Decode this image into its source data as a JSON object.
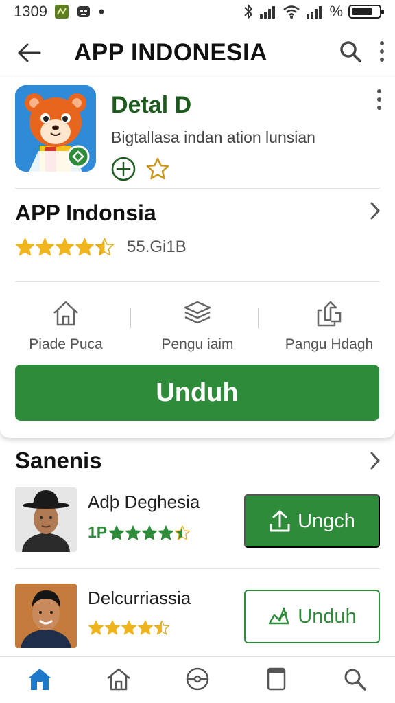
{
  "status_bar": {
    "time": "1309",
    "signal_percent": "%"
  },
  "app_bar": {
    "title": "APP INDONESIA"
  },
  "header": {
    "title": "Detal D",
    "subtitle": "Bigtallasa indan ation lunsian"
  },
  "rating_section": {
    "title": "APP Indonsia",
    "rating": 4.5,
    "size": "55.Gi1B"
  },
  "actions": [
    {
      "label": "Piade Puca",
      "icon": "home-outline-icon"
    },
    {
      "label": "Pengu iaim",
      "icon": "layers-icon"
    },
    {
      "label": "Pangu Hdagh",
      "icon": "share-icon"
    }
  ],
  "primary_button": {
    "label": "Unduh"
  },
  "section": {
    "title": "Sanenis"
  },
  "list": [
    {
      "name": "Adþ Deghesia",
      "prefix": "1P",
      "rating": 4.5,
      "button": "Ungch",
      "style": "filled"
    },
    {
      "name": "Delcurriassia",
      "prefix": "",
      "rating": 4.5,
      "button": "Unduh",
      "style": "outline"
    }
  ],
  "bottom_nav": [
    {
      "icon": "home-filled-icon",
      "active": true
    },
    {
      "icon": "home-outline-icon",
      "active": false
    },
    {
      "icon": "ball-icon",
      "active": false
    },
    {
      "icon": "tablet-icon",
      "active": false
    },
    {
      "icon": "search-icon",
      "active": false
    }
  ],
  "colors": {
    "accent": "#2e8b3a",
    "header_title": "#1d5a1d",
    "star": "#f0b41c",
    "nav_active": "#1f79c9"
  }
}
